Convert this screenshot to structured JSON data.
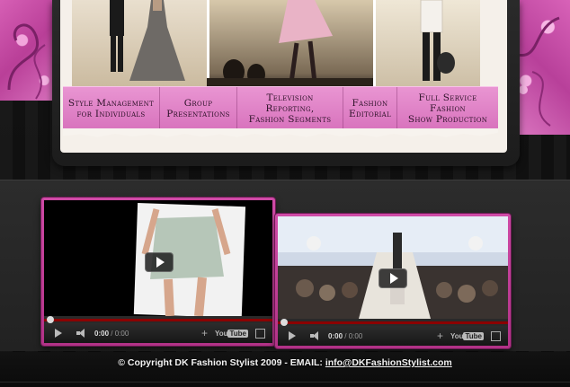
{
  "nav": {
    "items": [
      {
        "line1": "Style Management",
        "line2": "for Individuals"
      },
      {
        "line1": "Group",
        "line2": "Presentations"
      },
      {
        "line1": "Television Reporting,",
        "line2": "Fashion Segments"
      },
      {
        "line1": "Fashion",
        "line2": "Editorial"
      },
      {
        "line1": "Full Service Fashion",
        "line2": "Show Production"
      }
    ]
  },
  "videos": [
    {
      "time_current": "0:00",
      "time_sep": "/",
      "time_total": "0:00",
      "youtube_label": "You",
      "youtube_tube": "Tube"
    },
    {
      "time_current": "0:00",
      "time_sep": "/",
      "time_total": "0:00",
      "youtube_label": "You",
      "youtube_tube": "Tube"
    }
  ],
  "footer": {
    "copyright": "© Copyright DK Fashion Stylist 2009 - EMAIL: ",
    "email": "info@DKFashionStylist.com"
  },
  "colors": {
    "accent_pink": "#d873bd",
    "frame_pink": "#c23e97",
    "background": "#0f0f10"
  }
}
